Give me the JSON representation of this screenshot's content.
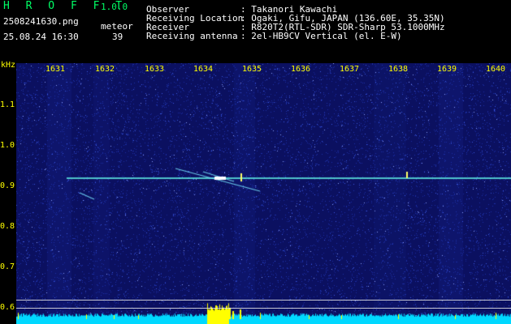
{
  "app": {
    "name": "H R O F F T",
    "version": "1.0.0"
  },
  "file": {
    "name": "2508241630.png",
    "datetime": "25.08.24 16:30"
  },
  "meteor": {
    "label": "meteor",
    "count": "39"
  },
  "info": {
    "observer_label": "Observer",
    "observer_value": ": Takanori Kawachi",
    "location_label": "Receiving Location",
    "location_value": ": Ogaki, Gifu, JAPAN (136.60E, 35.35N)",
    "receiver_label": "Receiver",
    "receiver_value": ": R820T2(RTL-SDR) SDR-Sharp 53.1000MHz",
    "antenna_label": "Receiving antenna",
    "antenna_value": ": 2el-HB9CV Vertical (el. E-W)"
  },
  "axis": {
    "y_unit": "kHz",
    "x_ticks": [
      "1631",
      "1632",
      "1633",
      "1634",
      "1635",
      "1636",
      "1637",
      "1638",
      "1639",
      "1640"
    ],
    "y_ticks": [
      "1.1",
      "1.0",
      "0.9",
      "0.8",
      "0.7",
      "0.6"
    ]
  },
  "colors": {
    "background": "#0b1060",
    "carrier": "#66ffee",
    "level": "#00d8ff",
    "text_white": "#ffffff",
    "text_yellow": "#ffff00",
    "text_green": "#00ff66"
  }
}
